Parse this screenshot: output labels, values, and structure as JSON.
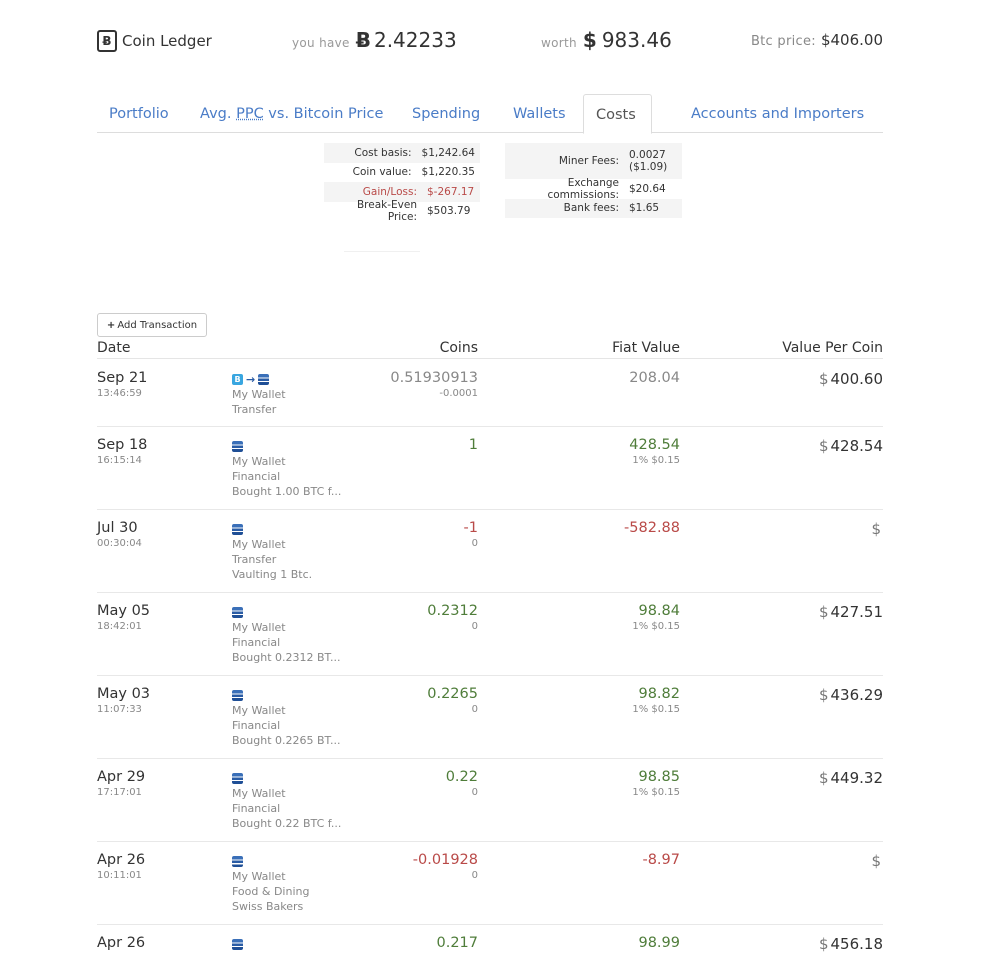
{
  "header": {
    "app_name": "Coin Ledger",
    "brand_icon_glyph": "Ƀ",
    "you_have_label": "you have",
    "btc_symbol": "Ƀ",
    "btc_amount": "2.42233",
    "worth_label": "worth",
    "usd_symbol": "$",
    "worth_amount": "983.46",
    "price_label": "Btc price:",
    "price_value": "$406.00"
  },
  "tabs": [
    {
      "label": "Portfolio",
      "active": false
    },
    {
      "label_pre": "Avg. ",
      "label_ppc": "PPC",
      "label_post": " vs. Bitcoin Price",
      "active": false
    },
    {
      "label": "Spending",
      "active": false
    },
    {
      "label": "Wallets",
      "active": false
    },
    {
      "label": "Costs",
      "active": true
    },
    {
      "label": "Accounts and Importers",
      "active": false
    }
  ],
  "stats_left": [
    {
      "label": "Cost basis:",
      "value": "$1,242.64"
    },
    {
      "label": "Coin value:",
      "value": "$1,220.35"
    },
    {
      "label": "Gain/Loss:",
      "value": "$-267.17"
    },
    {
      "label": "Break-Even Price:",
      "value": "$503.79"
    }
  ],
  "stats_right": [
    {
      "label": "Miner Fees:",
      "value_line1": "0.0027",
      "value_line2": "($1.09)"
    },
    {
      "label": "Exchange commissions:",
      "value": "$20.64"
    },
    {
      "label": "Bank fees:",
      "value": "$1.65"
    }
  ],
  "add_transaction_label": "Add Transaction",
  "table": {
    "columns": {
      "date": "Date",
      "coins": "Coins",
      "fiat": "Fiat Value",
      "vpc": "Value Per Coin"
    },
    "rows": [
      {
        "date": "Sep 21",
        "time": "13:46:59",
        "icons": "transfer",
        "wallet": "My Wallet",
        "category": "Transfer",
        "note": "",
        "coins": "0.51930913",
        "coins_sub": "-0.0001",
        "fiat": "208.04",
        "fiat_sub": "",
        "vpc_symbol": "$",
        "vpc": "400.60",
        "tone": "neutral"
      },
      {
        "date": "Sep 18",
        "time": "16:15:14",
        "icons": "coin",
        "wallet": "My Wallet",
        "category": "Financial",
        "note": "Bought 1.00 BTC f...",
        "coins": "1",
        "coins_sub": "",
        "fiat": "428.54",
        "fiat_sub": "1% $0.15",
        "vpc_symbol": "$",
        "vpc": "428.54",
        "tone": "pos"
      },
      {
        "date": "Jul 30",
        "time": "00:30:04",
        "icons": "coin",
        "wallet": "My Wallet",
        "category": "Transfer",
        "note": "Vaulting 1 Btc.",
        "coins": "-1",
        "coins_sub": "0",
        "fiat": "-582.88",
        "fiat_sub": "",
        "vpc_symbol": "$",
        "vpc": "",
        "tone": "neg"
      },
      {
        "date": "May 05",
        "time": "18:42:01",
        "icons": "coin",
        "wallet": "My Wallet",
        "category": "Financial",
        "note": "Bought 0.2312 BT...",
        "coins": "0.2312",
        "coins_sub": "0",
        "fiat": "98.84",
        "fiat_sub": "1% $0.15",
        "vpc_symbol": "$",
        "vpc": "427.51",
        "tone": "pos"
      },
      {
        "date": "May 03",
        "time": "11:07:33",
        "icons": "coin",
        "wallet": "My Wallet",
        "category": "Financial",
        "note": "Bought 0.2265 BT...",
        "coins": "0.2265",
        "coins_sub": "0",
        "fiat": "98.82",
        "fiat_sub": "1% $0.15",
        "vpc_symbol": "$",
        "vpc": "436.29",
        "tone": "pos"
      },
      {
        "date": "Apr 29",
        "time": "17:17:01",
        "icons": "coin",
        "wallet": "My Wallet",
        "category": "Financial",
        "note": "Bought 0.22 BTC f...",
        "coins": "0.22",
        "coins_sub": "0",
        "fiat": "98.85",
        "fiat_sub": "1% $0.15",
        "vpc_symbol": "$",
        "vpc": "449.32",
        "tone": "pos"
      },
      {
        "date": "Apr 26",
        "time": "10:11:01",
        "icons": "coin",
        "wallet": "My Wallet",
        "category": "Food & Dining",
        "note": "Swiss Bakers",
        "coins": "-0.01928",
        "coins_sub": "0",
        "fiat": "-8.97",
        "fiat_sub": "",
        "vpc_symbol": "$",
        "vpc": "",
        "tone": "neg"
      },
      {
        "date": "Apr 26",
        "time": "",
        "icons": "coin",
        "wallet": "",
        "category": "",
        "note": "",
        "coins": "0.217",
        "coins_sub": "",
        "fiat": "98.99",
        "fiat_sub": "",
        "vpc_symbol": "$",
        "vpc": "456.18",
        "tone": "pos"
      }
    ]
  }
}
